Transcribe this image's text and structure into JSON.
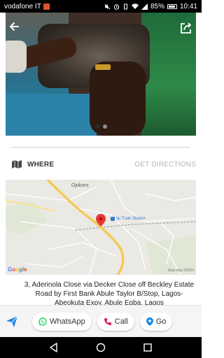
{
  "status_bar": {
    "carrier": "vodafone IT",
    "battery": "85%",
    "time": "10:41"
  },
  "gallery": {
    "image_count": 2,
    "active_index": 1
  },
  "location": {
    "where_label": "WHERE",
    "directions_label": "GET DIRECTIONS"
  },
  "map": {
    "labels": {
      "town": "Ojokoro",
      "station": "Iju Train Station",
      "brand": "Google",
      "copyright": "Map data ©2020"
    },
    "pin_color": "#e53935"
  },
  "address": "3, Aderinola Close via Decker Close off Beckley Estate Road by First Bank Abule Taylor B/Stop, Lagos-Abeokuta Expy, Abule Egba, Lagos",
  "actions": {
    "whatsapp_label": "WhatsApp",
    "call_label": "Call",
    "go_label": "Go"
  },
  "colors": {
    "accent_blue": "#1e88e5",
    "whatsapp_green": "#25d366",
    "call_red": "#d81b60"
  },
  "icons": {
    "back": "arrow-left-icon",
    "share": "share-icon",
    "map": "map-icon",
    "send": "send-icon",
    "whatsapp": "whatsapp-icon",
    "phone": "phone-icon",
    "pin": "location-pin-icon"
  }
}
